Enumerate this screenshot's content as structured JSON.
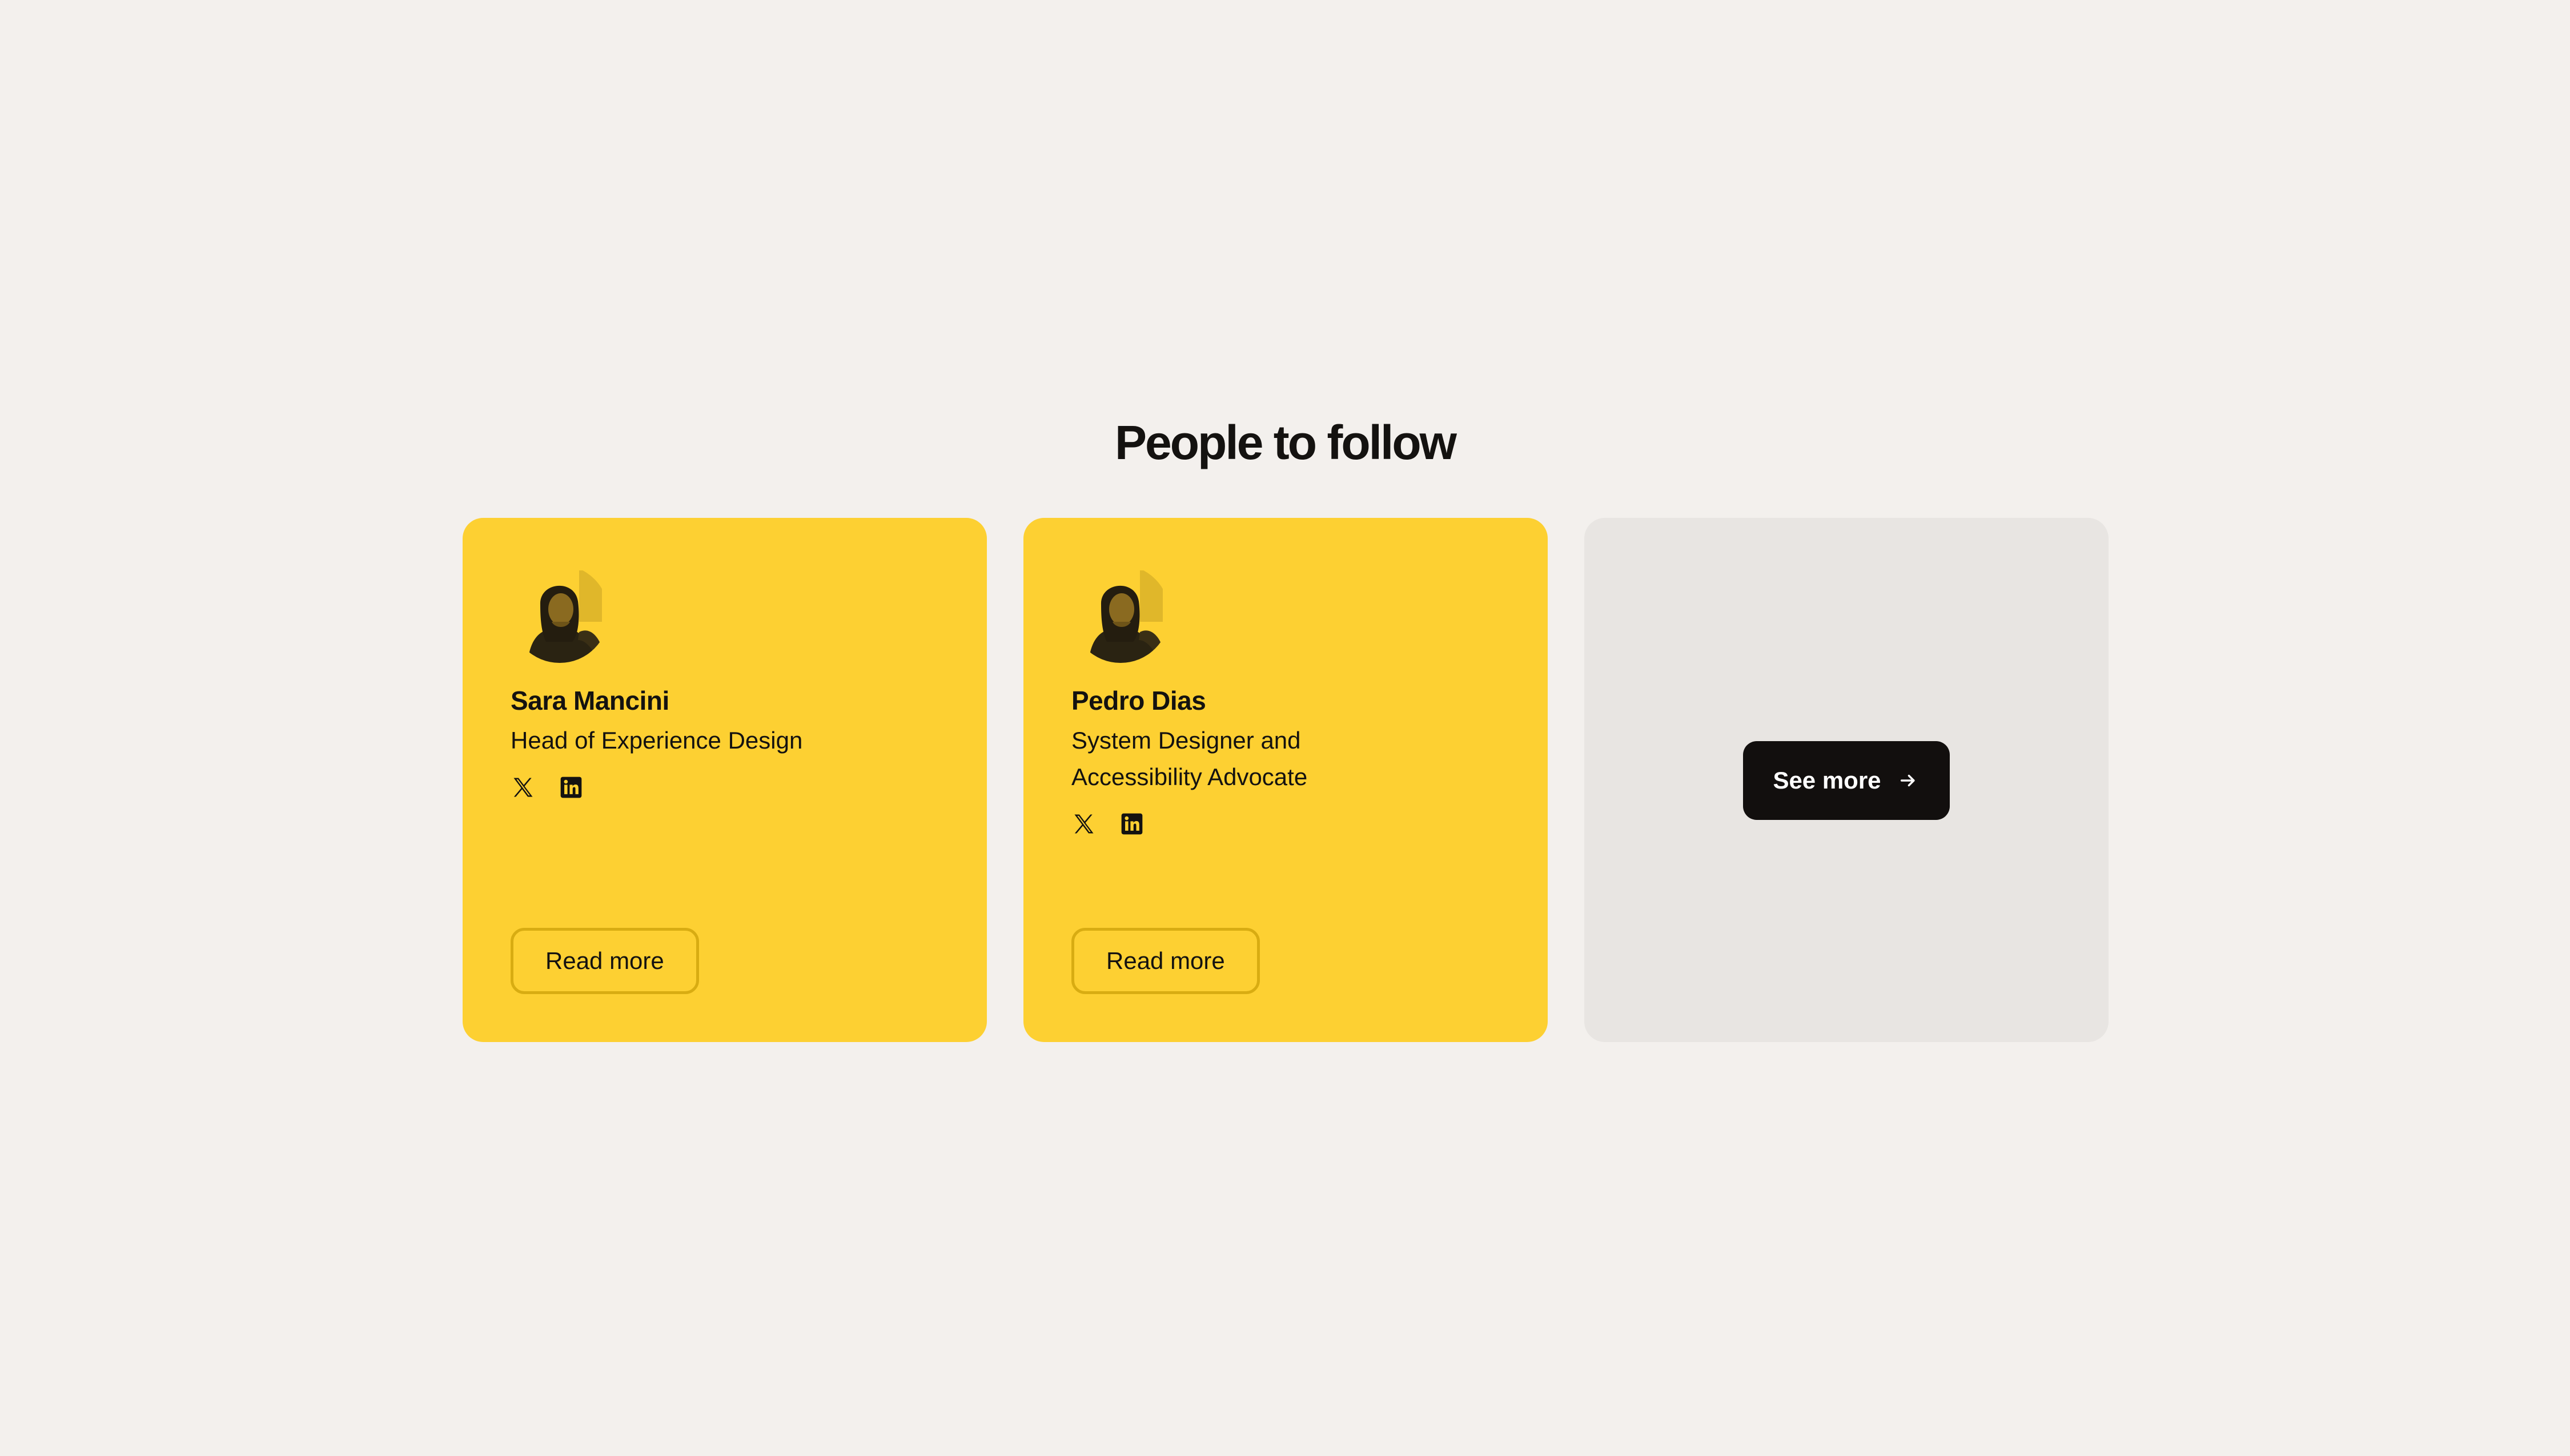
{
  "section": {
    "title": "People to follow"
  },
  "people": [
    {
      "name": "Sara Mancini",
      "role": "Head of Experience Design",
      "socials": [
        "x-icon",
        "linkedin-icon"
      ],
      "cta_label": "Read more"
    },
    {
      "name": "Pedro Dias",
      "role": "System Designer and Accessibility Advocate",
      "socials": [
        "x-icon",
        "linkedin-icon"
      ],
      "cta_label": "Read more"
    }
  ],
  "more_card": {
    "label": "See more",
    "icon": "arrow-right-icon"
  },
  "colors": {
    "background": "#f3f0ed",
    "card_accent": "#fdd032",
    "card_muted": "#e8e5e2",
    "button_dark": "#120f0e",
    "text": "#141210"
  }
}
